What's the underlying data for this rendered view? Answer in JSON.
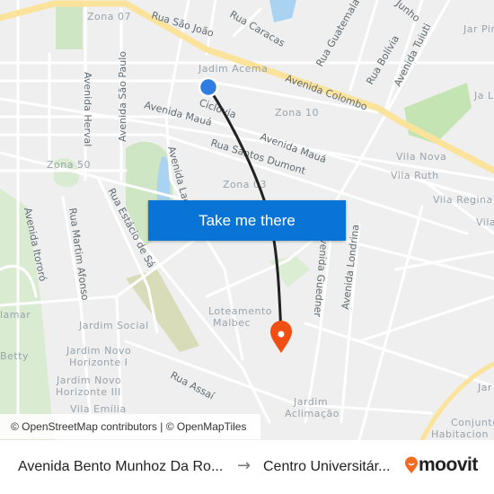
{
  "map": {
    "labels": {
      "zona07": "Zona 07",
      "rua_sao_joao": "Rua São João",
      "rua_caracas": "Rua Caracas",
      "rua_guatemala": "Rua Guatemala",
      "junho": "Junho",
      "rua_bolivia": "Rua Bolívia",
      "av_tuiuti": "Avenida Tuiuti",
      "jardim_pinheiros": "Jar Pinhe",
      "jardim_liberdade": "Ja Libe",
      "jadim_acema": "Jadim Acema",
      "av_colombo": "Avenida Colombo",
      "ciclovia": "Ciclovia",
      "zona10": "Zona 10",
      "av_herval": "Avenida Herval",
      "av_sao_paulo": "Avenida São Paulo",
      "av_maua_1": "Avenida Mauá",
      "av_maua_2": "Avenida Mauá",
      "rua_santos_dumont": "Rua Santos Dumont",
      "vila_nova": "Vila Nova",
      "vila_ruth": "Vila Ruth",
      "zona50": "Zona 50",
      "av_lago": "Avenida Lag",
      "zona03": "Zona 03",
      "vila_regina": "Vila Regina",
      "vila_right": "Vila",
      "av_itororo": "Avenida Itororó",
      "rua_martim_afonso": "Rua Martim Afonso",
      "rua_estacio_de_sa": "Rua Estácio de Sá",
      "av_guedner": "Avenida Guedner",
      "av_londrina": "Avenida Londrina",
      "lamar": "lamar",
      "jardim_social": "Jardim Social",
      "loteamento_malbec_1": "Loteamento",
      "loteamento_malbec_2": "Malbec",
      "betty": "Betty",
      "jardim_novo_horizonte_i_1": "Jardim Novo",
      "jardim_novo_horizonte_i_2": "Horizonte I",
      "jardim_novo_horizonte_iii_1": "Jardim Novo",
      "jardim_novo_horizonte_iii_2": "Horizonte III",
      "rua_assai": "Rua Assaí",
      "vila_emilia": "Vila Emília",
      "jardim_aclimacao_1": "Jardim",
      "jardim_aclimacao_2": "Aclimação",
      "jar_right": "Jar",
      "conjunto_1": "Conjunto",
      "conjunto_2": "Habitacion"
    },
    "origin_marker_color": "#2f7de1",
    "destination_marker_color": "#f04e13",
    "route_color": "#222222"
  },
  "cta": {
    "label": "Take me there",
    "color": "#0a74d6"
  },
  "attribution": "© OpenStreetMap contributors | © OpenMapTiles",
  "footer": {
    "origin": "Avenida Bento Munhoz Da Ro...",
    "arrow": "→",
    "destination": "Centro Universitár...",
    "brand": "moovit",
    "brand_color": "#f26b21"
  }
}
